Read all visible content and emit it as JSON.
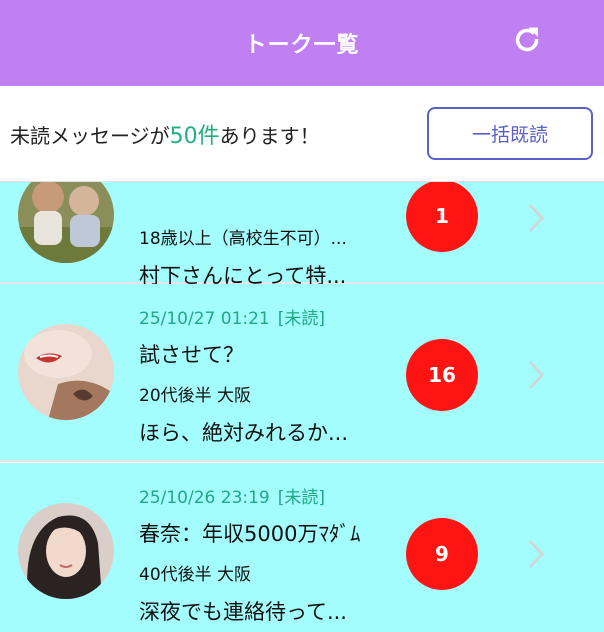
{
  "header": {
    "title": "トーク一覧",
    "refresh_icon": "refresh-icon"
  },
  "unread": {
    "prefix": "未読メッセージが",
    "count": "50件",
    "suffix": "あります！",
    "mark_all_label": "一括既読"
  },
  "colors": {
    "header_bg": "#c07ff2",
    "row_bg": "#a4fdfd",
    "badge_bg": "#ff1414",
    "accent_green": "#22a884",
    "button_border": "#5a62c8"
  },
  "conversations": [
    {
      "date": "",
      "unread_tag": "",
      "name": "",
      "sub": "18歳以上（高校生不可）...",
      "message": "村下さんにとって特...",
      "badge": "1"
    },
    {
      "date": "25/10/27 01:21",
      "unread_tag": "[未読]",
      "name": "試させて？",
      "sub": "20代後半 大阪",
      "message": "ほら、絶対みれるか...",
      "badge": "16"
    },
    {
      "date": "25/10/26 23:19",
      "unread_tag": "[未読]",
      "name": "春奈：年収5000万ﾏﾀﾞﾑ",
      "sub": "40代後半 大阪",
      "message": "深夜でも連絡待って...",
      "badge": "9"
    }
  ]
}
